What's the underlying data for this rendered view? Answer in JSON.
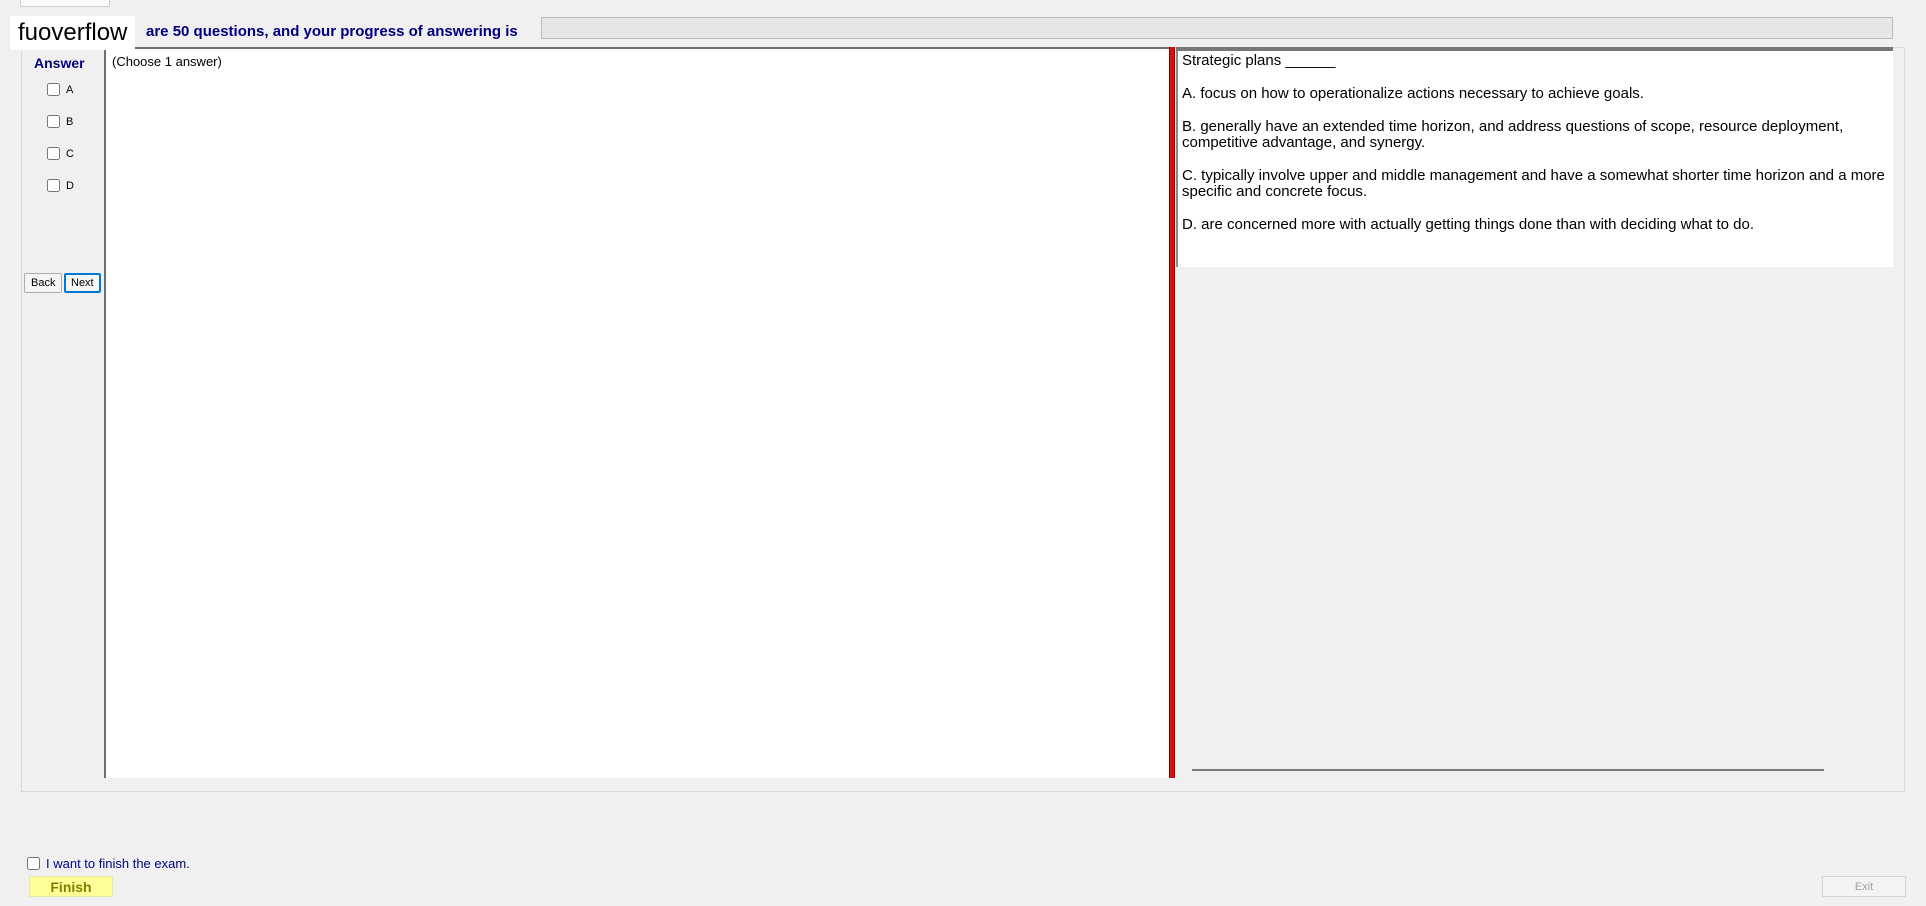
{
  "watermark": "fuoverflow",
  "header": {
    "progress_text": "are 50 questions, and your progress of answering is",
    "progress_value": 0
  },
  "answer_panel": {
    "title": "Answer",
    "options": [
      "A",
      "B",
      "C",
      "D"
    ],
    "back_label": "Back",
    "next_label": "Next"
  },
  "left_pane": {
    "instruction": "(Choose 1 answer)"
  },
  "question": {
    "stem": "Strategic plans ______",
    "choices": [
      "A.  focus on how to operationalize actions necessary to achieve goals.",
      "B.  generally have an extended time horizon, and address questions of scope, resource deployment, competitive advantage, and synergy.",
      "C.  typically involve upper and middle management and have a somewhat shorter time horizon and a more specific and concrete focus.",
      "D.  are concerned more with actually getting things done than with deciding what to do."
    ]
  },
  "footer": {
    "finish_check_label": "I want to finish the exam.",
    "finish_label": "Finish",
    "exit_label": "Exit"
  },
  "colors": {
    "accent_text": "#000080",
    "splitter": "#dd1010",
    "finish_bg": "#ffff99"
  }
}
